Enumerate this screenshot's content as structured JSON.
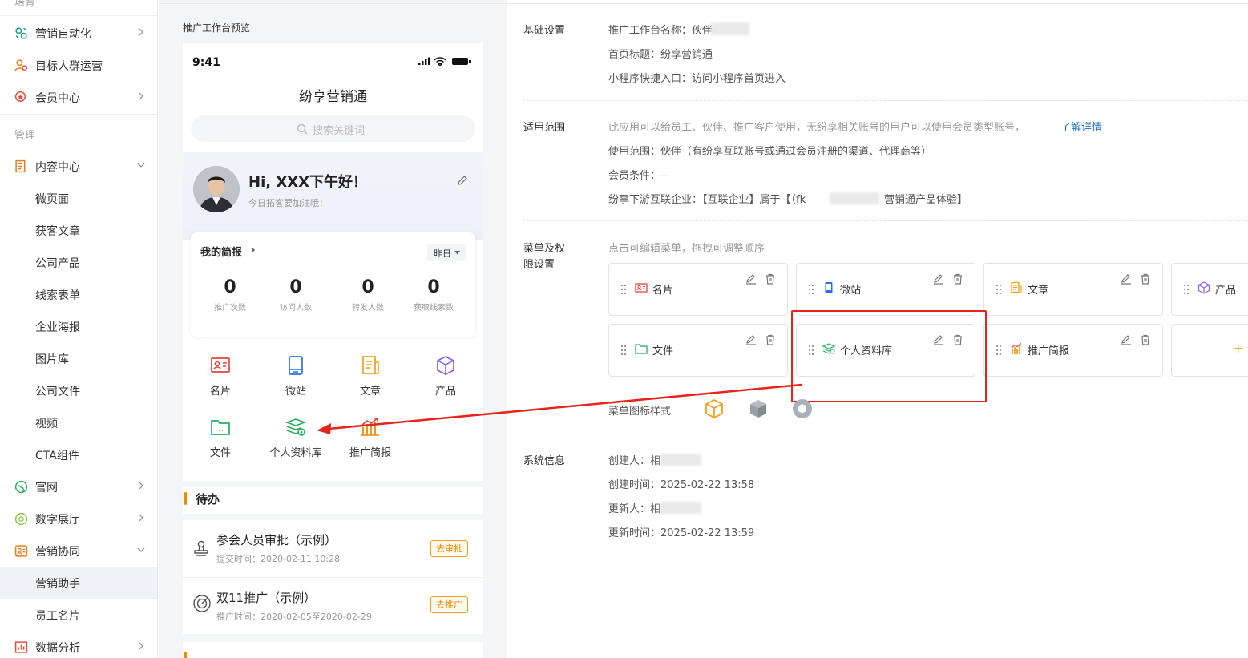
{
  "sidebar": {
    "top_cut": "培育",
    "items_top": [
      {
        "label": "营销自动化",
        "icon": "automation-icon",
        "chevron": "right"
      },
      {
        "label": "目标人群运营",
        "icon": "audience-icon",
        "chevron": ""
      },
      {
        "label": "会员中心",
        "icon": "member-icon",
        "chevron": "right"
      }
    ],
    "group_manage": "管理",
    "content_center": {
      "label": "内容中心",
      "chevron": "down"
    },
    "content_sub": [
      "微页面",
      "获客文章",
      "公司产品",
      "线索表单",
      "企业海报",
      "图片库",
      "公司文件",
      "视频",
      "CTA组件"
    ],
    "official_site": "官网",
    "digital_hall": "数字展厅",
    "marketing_collab": "营销协同",
    "collab_sub": [
      "营销助手",
      "员工名片"
    ],
    "data_analysis": "数据分析"
  },
  "preview": {
    "title": "推广工作台预览",
    "status_time": "9:41",
    "app_title": "纷享营销通",
    "search_placeholder": "搜索关键词",
    "greeting": "Hi, XXX下午好！",
    "greeting_sub": "今日拓客要加油哦！",
    "brief_title": "我的简报",
    "period": "昨日",
    "stats": [
      {
        "value": "0",
        "label": "推广次数"
      },
      {
        "value": "0",
        "label": "访问人数"
      },
      {
        "value": "0",
        "label": "转发人数"
      },
      {
        "value": "0",
        "label": "获取线索数"
      }
    ],
    "menu": [
      {
        "label": "名片",
        "icon": "card-icon"
      },
      {
        "label": "微站",
        "icon": "microsite-icon"
      },
      {
        "label": "文章",
        "icon": "article-icon"
      },
      {
        "label": "产品",
        "icon": "product-icon"
      },
      {
        "label": "文件",
        "icon": "folder-icon"
      },
      {
        "label": "个人资料库",
        "icon": "library-icon"
      },
      {
        "label": "推广简报",
        "icon": "report-icon"
      }
    ],
    "todo_title": "待办",
    "todos": [
      {
        "title": "参会人员审批（示例）",
        "meta": "提交时间：2020-02-11 10:28",
        "action": "去审批"
      },
      {
        "title": "双11推广（示例）",
        "meta": "推广时间：2020-02-05至2020-02-29",
        "action": "去推广"
      }
    ]
  },
  "settings": {
    "basic": {
      "label": "基础设置",
      "name_line": "推广工作台名称：伙伴",
      "home_title": "首页标题：纷享营销通",
      "entry": "小程序快捷入口：访问小程序首页进入"
    },
    "scope": {
      "label": "适用范围",
      "desc": "此应用可以给员工、伙伴、推广客户使用，无纷享相关账号的用户可以使用会员类型账号，",
      "link": "了解详情",
      "range": "使用范围：伙伴（有纷享互联账号或通过会员注册的渠道、代理商等）",
      "member_cond": "会员条件：--",
      "downstream_prefix": "纷享下游互联企业：【互联企业】属于【（fk",
      "downstream_suffix": "营销通产品体验】"
    },
    "menu": {
      "label_line1": "菜单及权",
      "label_line2": "限设置",
      "hint": "点击可编辑菜单，拖拽可调整顺序",
      "cards": [
        {
          "label": "名片",
          "icon": "card-icon"
        },
        {
          "label": "微站",
          "icon": "microsite-icon"
        },
        {
          "label": "文章",
          "icon": "article-icon"
        },
        {
          "label": "产品",
          "icon": "product-icon"
        },
        {
          "label": "文件",
          "icon": "folder-icon"
        },
        {
          "label": "个人资料库",
          "icon": "library-icon"
        },
        {
          "label": "推广简报",
          "icon": "report-icon"
        }
      ],
      "add_label": "+",
      "icon_style_label": "菜单图标样式"
    },
    "system": {
      "label": "系统信息",
      "creator": "创建人：相",
      "created_at": "创建时间：2025-02-22 13:58",
      "updater": "更新人：相",
      "updated_at": "更新时间：2025-02-22 13:59"
    }
  },
  "colors": {
    "accent_blue": "#1c6dd0",
    "highlight_red": "#e8231b",
    "orange": "#f08a00"
  }
}
